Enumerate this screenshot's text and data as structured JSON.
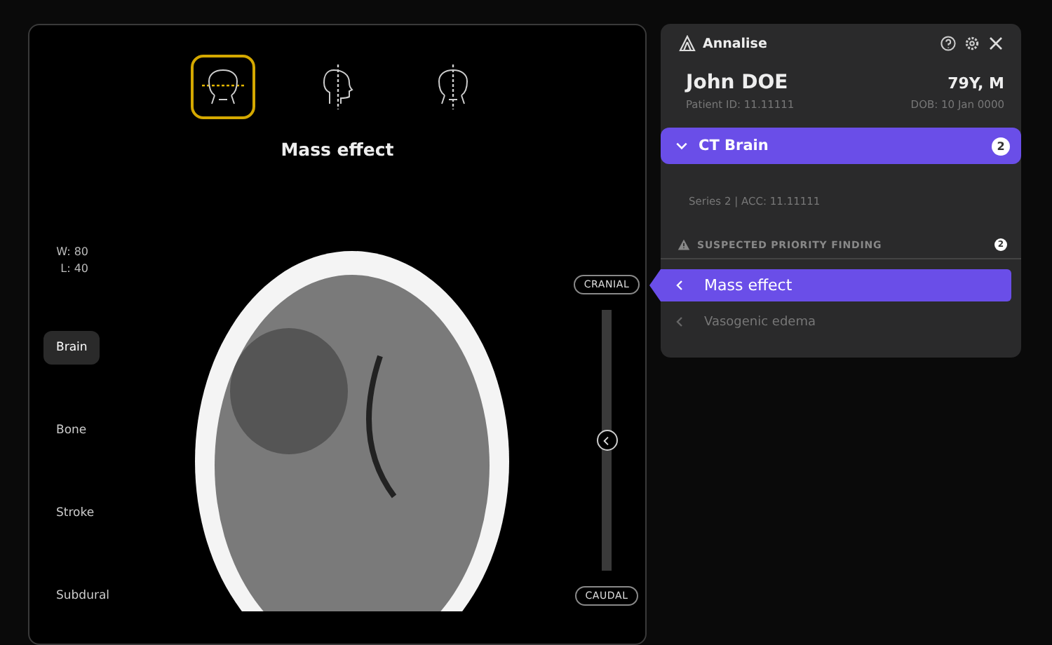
{
  "viewer": {
    "planes": [
      {
        "kind": "axial",
        "selected": true
      },
      {
        "kind": "sagittal",
        "selected": false
      },
      {
        "kind": "coronal",
        "selected": false
      }
    ],
    "title": "Mass effect",
    "window_level": [
      "W: 80",
      "L: 40"
    ],
    "presets": [
      {
        "label": "Brain",
        "selected": true
      },
      {
        "label": "Bone",
        "selected": false
      },
      {
        "label": "Stroke",
        "selected": false
      },
      {
        "label": "Subdural",
        "selected": false
      }
    ],
    "slider": {
      "top_label": "CRANIAL",
      "bottom_label": "CAUDAL",
      "level": 0.5
    }
  },
  "panel": {
    "brand": "Annalise",
    "patient": {
      "name": "John DOE",
      "age_sex": "79Y, M",
      "patient_id": "Patient ID: 11.11111",
      "dob": "DOB: 10 Jan 0000"
    },
    "study": {
      "title": "CT Brain",
      "count": "2",
      "expanded": true,
      "series": "Series 2 | ACC: 11.11111"
    },
    "section": {
      "title": "SUSPECTED PRIORITY FINDING",
      "count": "2"
    },
    "findings": [
      {
        "label": "Mass effect",
        "selected": true
      },
      {
        "label": "Vasogenic edema",
        "selected": false
      }
    ]
  }
}
